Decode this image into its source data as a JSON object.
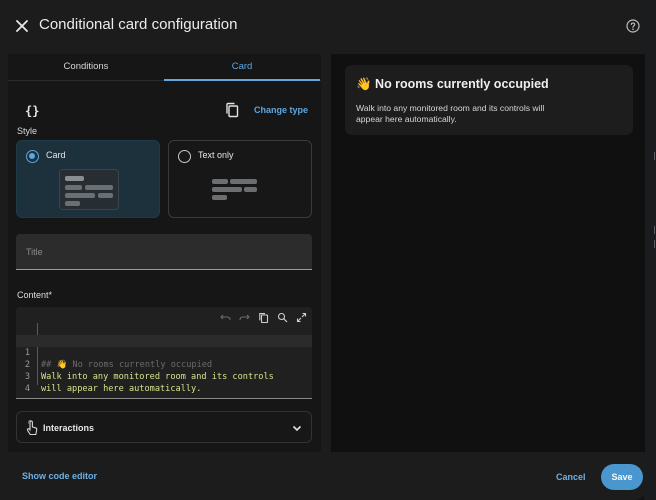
{
  "dialog": {
    "title": "Conditional card configuration"
  },
  "tabs": [
    {
      "label": "Conditions"
    },
    {
      "label": "Card"
    }
  ],
  "editor": {
    "braces": "{}",
    "change_type": "Change type",
    "style_label": "Style",
    "options": [
      {
        "label": "Card",
        "selected": true
      },
      {
        "label": "Text only",
        "selected": false
      }
    ],
    "title_placeholder": "Title",
    "title_value": "",
    "content_label": "Content*",
    "code_lines": [
      {
        "n": "1",
        "text": "## 👋 No rooms currently occupied"
      },
      {
        "n": "2",
        "text": "Walk into any monitored room and its controls"
      },
      {
        "n": "3",
        "text": "will appear here automatically."
      },
      {
        "n": "4",
        "text": ""
      }
    ],
    "interactions_label": "Interactions"
  },
  "preview": {
    "title": "👋 No rooms currently occupied",
    "body": "Walk into any monitored room and its controls will appear here automatically."
  },
  "footer": {
    "show_code": "Show code editor",
    "cancel": "Cancel",
    "save": "Save"
  },
  "colors": {
    "accent": "#5ea6de",
    "save_button": "#4a97cf",
    "dialog_bg": "#1c1c1c",
    "selected_option_bg": "#1c313c"
  }
}
